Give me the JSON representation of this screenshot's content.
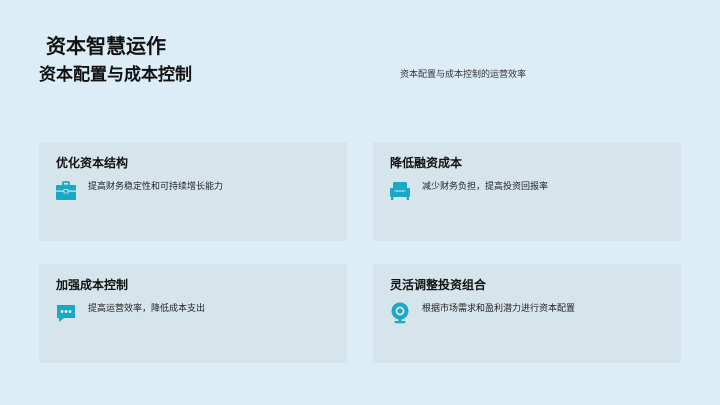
{
  "deck_title": "资本智慧运作",
  "slide": {
    "title": "资本配置与成本控制",
    "subtitle": "资本配置与成本控制的运营效率"
  },
  "accent_color": "#1aa8c4",
  "card_bg": "#d6e5ec",
  "cards": [
    {
      "title": "优化资本结构",
      "desc": "提高财务稳定性和可持续增长能力",
      "icon": "briefcase-icon"
    },
    {
      "title": "降低融资成本",
      "desc": "减少财务负担，提高投资回报率",
      "icon": "armchair-icon"
    },
    {
      "title": "加强成本控制",
      "desc": "提高运营效率，降低成本支出",
      "icon": "chat-bubble-icon"
    },
    {
      "title": "灵活调整投资组合",
      "desc": "根据市场需求和盈利潜力进行资本配置",
      "icon": "webcam-icon"
    }
  ]
}
